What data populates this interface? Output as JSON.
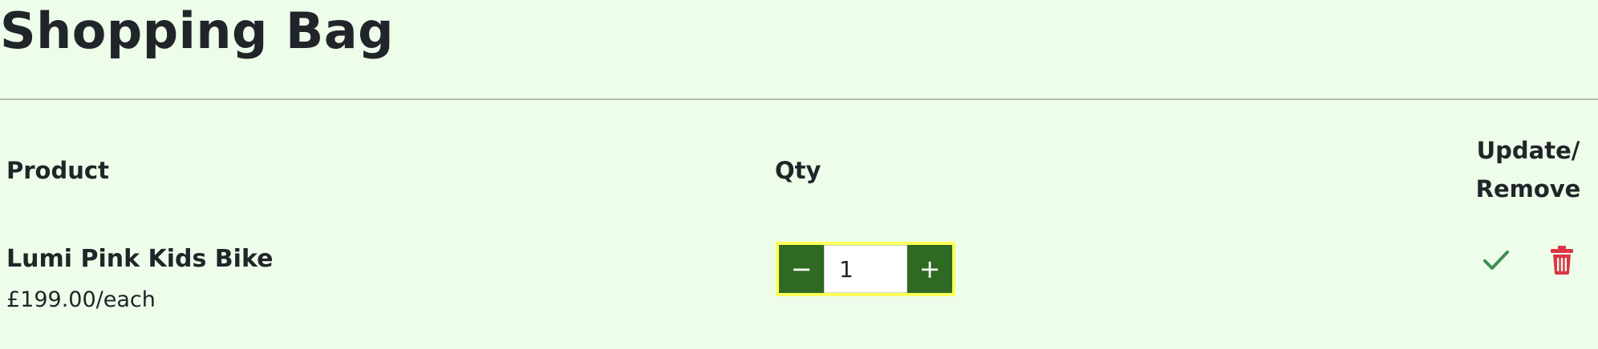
{
  "page": {
    "title": "Shopping Bag"
  },
  "table": {
    "headers": {
      "product": "Product",
      "qty": "Qty",
      "update_line1": "Update/",
      "update_line2": "Remove"
    },
    "rows": [
      {
        "product_name": "Lumi Pink Kids Bike",
        "price": "£199.00/each",
        "qty": "1",
        "decrement_label": "−",
        "increment_label": "+"
      }
    ]
  },
  "icons": {
    "update": "check-icon",
    "remove": "trash-icon"
  },
  "colors": {
    "background": "#edfdea",
    "qty_button": "#2f6a22",
    "qty_focus_border": "#ffff5a",
    "update_icon": "#3f8f55",
    "remove_icon": "#dc3545"
  }
}
